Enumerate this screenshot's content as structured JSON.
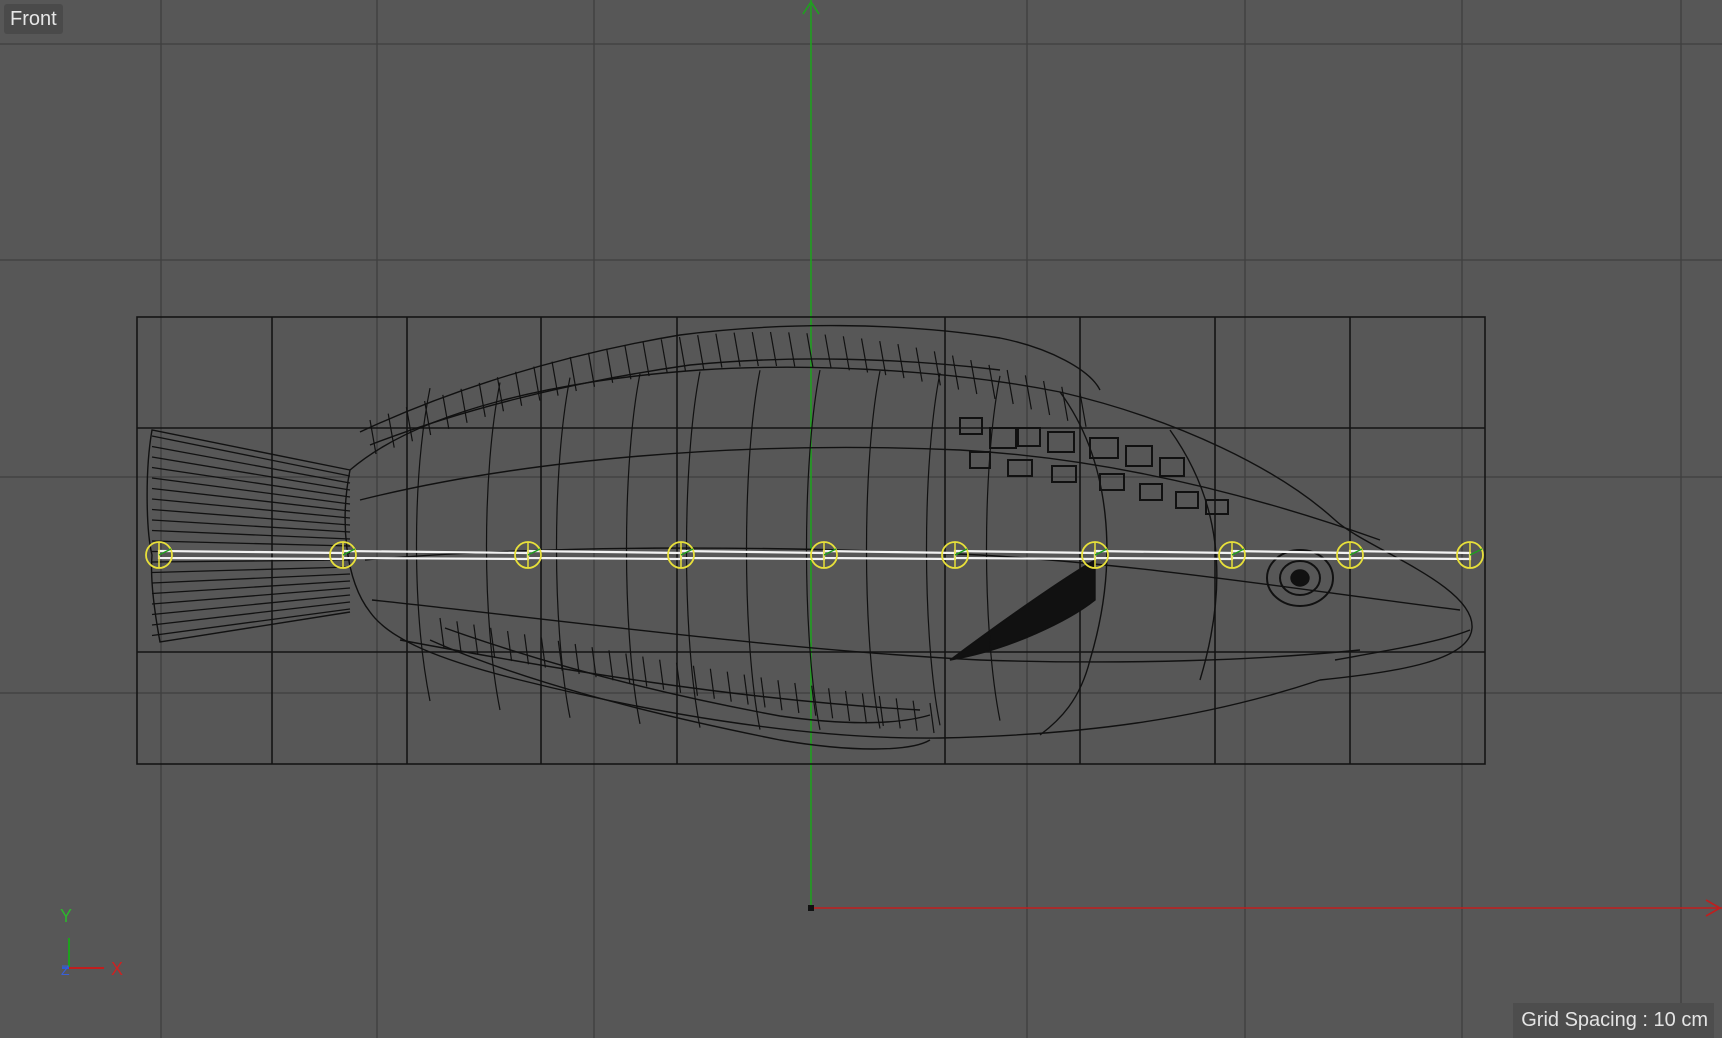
{
  "viewport": {
    "view_label": "Front",
    "grid_spacing_text": "Grid Spacing : 10 cm",
    "colors": {
      "background": "#575757",
      "grid_line": "#3f3f3f",
      "wireframe": "#111111",
      "y_axis": "#1fa01f",
      "x_axis": "#c01e1e",
      "joint": "#e8e03a",
      "bone": "#f2f2f2"
    },
    "axis_gizmo": {
      "y_label": "Y",
      "x_label": "X",
      "z_label": "Z"
    },
    "object": {
      "name_icon": "fish-wireframe-mesh",
      "joint_count": 10
    }
  }
}
